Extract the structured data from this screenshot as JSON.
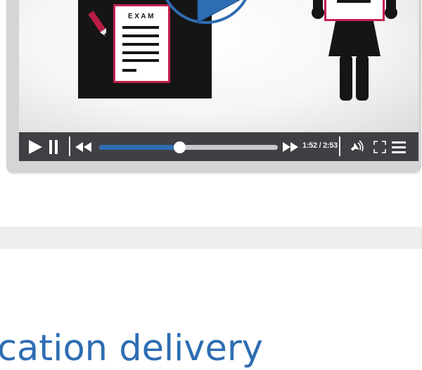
{
  "player": {
    "exam_label": "EXAM",
    "time_display": "1:52 / 2:53",
    "progress": 0.45,
    "accent_color": "#2e6db3",
    "controls_bg": "#3e4043",
    "icons": [
      "play-icon",
      "pause-icon",
      "rewind-icon",
      "fast-forward-icon",
      "volume-icon",
      "fullscreen-icon",
      "menu-icon"
    ]
  },
  "heading": {
    "text": "cation delivery"
  }
}
